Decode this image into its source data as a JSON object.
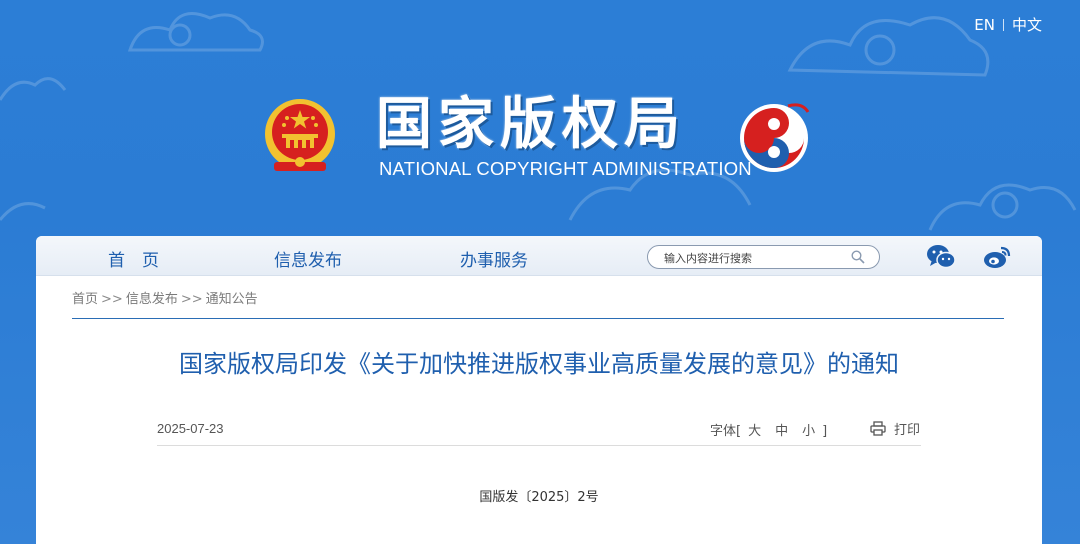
{
  "header": {
    "lang_en": "EN",
    "lang_zh": "中文",
    "title_cn": "国家版权局",
    "title_en": "NATIONAL COPYRIGHT ADMINISTRATION"
  },
  "nav": {
    "items": [
      {
        "label": "首　页"
      },
      {
        "label": "信息发布"
      },
      {
        "label": "办事服务"
      }
    ],
    "search_placeholder": "输入内容进行搜索"
  },
  "breadcrumb": {
    "items": [
      "首页",
      "信息发布",
      "通知公告"
    ],
    "separator": ">>"
  },
  "article": {
    "title": "国家版权局印发《关于加快推进版权事业高质量发展的意见》的通知",
    "date": "2025-07-23",
    "font_label": "字体",
    "font_open": "[",
    "font_close": "]",
    "font_large": "大",
    "font_medium": "中",
    "font_small": "小",
    "print_label": "打印",
    "doc_number": "国版发〔2025〕2号"
  },
  "colors": {
    "banner_blue": "#2c7ed6",
    "nav_text": "#1f5fae",
    "title_text": "#1f5fae",
    "emblem_red": "#d6201f",
    "emblem_gold": "#f2c230"
  },
  "icons": {
    "search": "search-icon",
    "wechat": "wechat-icon",
    "weibo": "weibo-icon",
    "print": "printer-icon"
  }
}
